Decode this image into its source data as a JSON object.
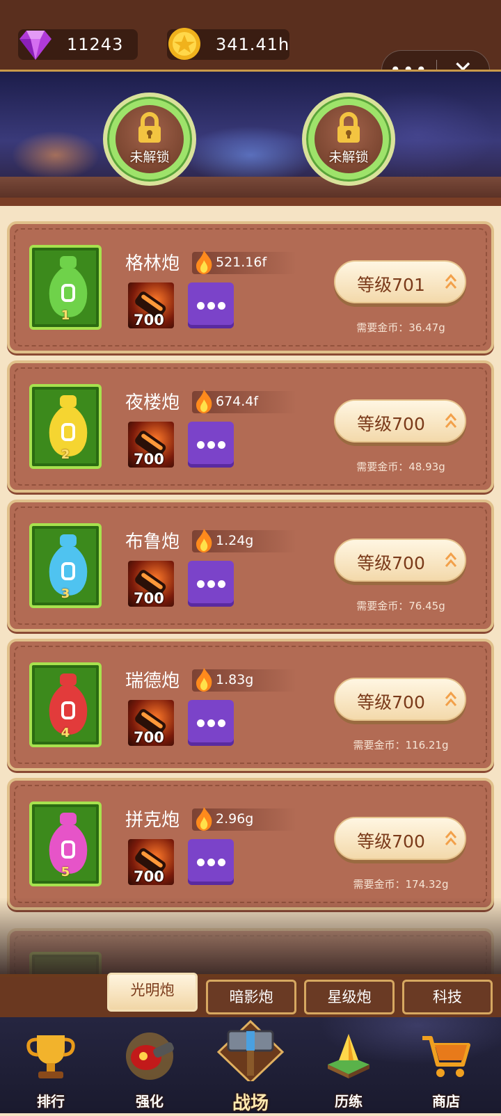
{
  "header": {
    "gems": "11243",
    "gold": "341.41h",
    "capsule_more": "•••",
    "capsule_close": "✕"
  },
  "banner": {
    "slots": [
      {
        "label": "未解锁"
      },
      {
        "label": "未解锁"
      }
    ]
  },
  "cannons": [
    {
      "name": "格林炮",
      "power": "521.16f",
      "rank": "1",
      "skill_level": "700",
      "level_label": "等级701",
      "cost": "需要金币：36.47g",
      "color": "#6fd24a"
    },
    {
      "name": "夜楼炮",
      "power": "674.4f",
      "rank": "2",
      "skill_level": "700",
      "level_label": "等级700",
      "cost": "需要金币：48.93g",
      "color": "#f5d531"
    },
    {
      "name": "布鲁炮",
      "power": "1.24g",
      "rank": "3",
      "skill_level": "700",
      "level_label": "等级700",
      "cost": "需要金币：76.45g",
      "color": "#4fc3f0"
    },
    {
      "name": "瑞德炮",
      "power": "1.83g",
      "rank": "4",
      "skill_level": "700",
      "level_label": "等级700",
      "cost": "需要金币：116.21g",
      "color": "#e23b3b"
    },
    {
      "name": "拼克炮",
      "power": "2.96g",
      "rank": "5",
      "skill_level": "700",
      "level_label": "等级700",
      "cost": "需要金币：174.32g",
      "color": "#e654c8"
    }
  ],
  "tabs": [
    "光明炮",
    "暗影炮",
    "星级炮",
    "科技"
  ],
  "bottom_nav": [
    "排行",
    "强化",
    "战场",
    "历练",
    "商店"
  ]
}
